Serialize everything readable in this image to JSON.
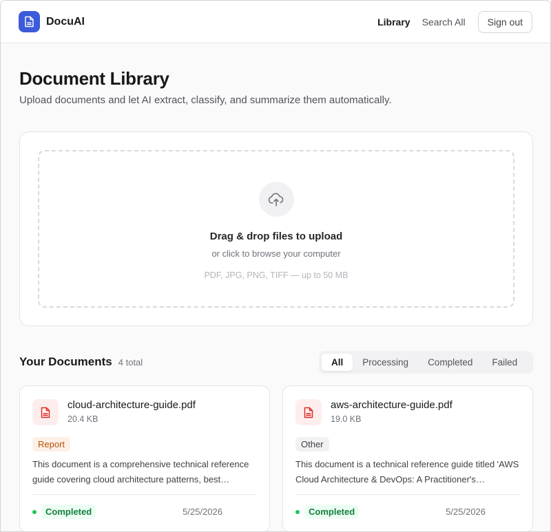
{
  "header": {
    "brand": "DocuAI",
    "nav": [
      {
        "label": "Library",
        "active": true
      },
      {
        "label": "Search All",
        "active": false
      }
    ],
    "signout_label": "Sign out"
  },
  "page": {
    "title": "Document Library",
    "subtitle": "Upload documents and let AI extract, classify, and summarize them automatically."
  },
  "upload": {
    "icon": "cloud-upload-icon",
    "title": "Drag & drop files to upload",
    "subtitle": "or click to browse your computer",
    "hint": "PDF, JPG, PNG, TIFF — up to 50 MB"
  },
  "documents": {
    "heading": "Your Documents",
    "count": "4 total",
    "filters": [
      {
        "label": "All",
        "active": true
      },
      {
        "label": "Processing",
        "active": false
      },
      {
        "label": "Completed",
        "active": false
      },
      {
        "label": "Failed",
        "active": false
      }
    ],
    "items": [
      {
        "name": "cloud-architecture-guide.pdf",
        "size": "20.4 KB",
        "type": "Report",
        "summary": "This document is a comprehensive technical reference guide covering cloud architecture patterns, best practices and deployment strategies.",
        "status": "Completed",
        "date": "5/25/2026"
      },
      {
        "name": "aws-architecture-guide.pdf",
        "size": "19.0 KB",
        "type": "Other",
        "summary": "This document is a technical reference guide titled 'AWS Cloud Architecture & DevOps: A Practitioner's Handbook'.",
        "status": "Completed",
        "date": "5/25/2026"
      }
    ]
  },
  "colors": {
    "accent": "#3b5bdb",
    "success": "#15803d",
    "report_badge": "#b45309",
    "file_icon": "#dc2626"
  }
}
